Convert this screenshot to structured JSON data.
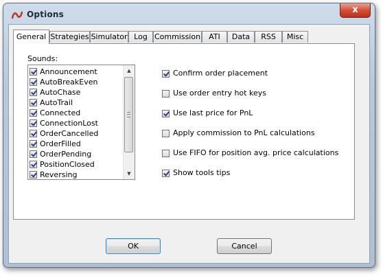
{
  "window": {
    "title": "Options",
    "close_glyph": "x",
    "app_icon": "ninjatrader-logo-icon",
    "accent_color": "#c0392b"
  },
  "tabs": [
    {
      "label": "General",
      "active": true
    },
    {
      "label": "Strategies",
      "active": false
    },
    {
      "label": "Simulator",
      "active": false
    },
    {
      "label": "Log",
      "active": false
    },
    {
      "label": "Commission",
      "active": false
    },
    {
      "label": "ATI",
      "active": false
    },
    {
      "label": "Data",
      "active": false
    },
    {
      "label": "RSS",
      "active": false
    },
    {
      "label": "Misc",
      "active": false
    }
  ],
  "sounds": {
    "label": "Sounds:",
    "items": [
      {
        "label": "Announcement",
        "checked": true
      },
      {
        "label": "AutoBreakEven",
        "checked": true
      },
      {
        "label": "AutoChase",
        "checked": true
      },
      {
        "label": "AutoTrail",
        "checked": true
      },
      {
        "label": "Connected",
        "checked": true
      },
      {
        "label": "ConnectionLost",
        "checked": true
      },
      {
        "label": "OrderCancelled",
        "checked": true
      },
      {
        "label": "OrderFilled",
        "checked": true
      },
      {
        "label": "OrderPending",
        "checked": true
      },
      {
        "label": "PositionClosed",
        "checked": true
      },
      {
        "label": "Reversing",
        "checked": true
      }
    ]
  },
  "options": [
    {
      "label": "Confirm order placement",
      "checked": true
    },
    {
      "label": "Use order entry hot keys",
      "checked": false
    },
    {
      "label": "Use last price for PnL",
      "checked": true
    },
    {
      "label": "Apply commission to PnL calculations",
      "checked": false
    },
    {
      "label": "Use FIFO for position avg. price calculations",
      "checked": false
    },
    {
      "label": "Show tools tips",
      "checked": true
    }
  ],
  "buttons": {
    "ok_label": "OK",
    "cancel_label": "Cancel"
  }
}
